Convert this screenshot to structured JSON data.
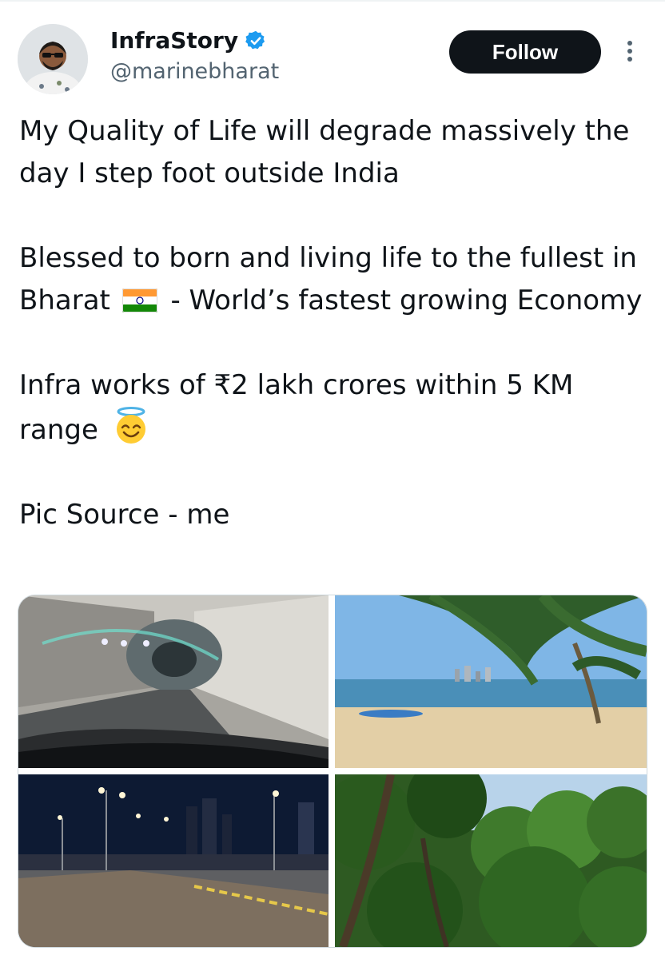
{
  "author": {
    "display_name": "InfraStory",
    "handle": "@marinebharat",
    "verified": true,
    "avatar_icon": "user-avatar"
  },
  "actions": {
    "follow_label": "Follow",
    "more_icon": "more-vertical-icon"
  },
  "tweet": {
    "paragraph_1": "My Quality of Life will degrade massively the day I step foot outside India",
    "paragraph_2_before_flag": "Blessed to born and living life to the fullest in Bharat",
    "paragraph_2_flag_icon": "india-flag-emoji",
    "paragraph_2_after_flag": "- World’s fastest growing Economy",
    "paragraph_3_text": "Infra works of ₹2 lakh crores within 5 KM range",
    "paragraph_3_emoji_icon": "smiling-face-with-halo-emoji",
    "paragraph_4": "Pic Source - me"
  },
  "media": [
    {
      "subject": "tunnel-photo"
    },
    {
      "subject": "beach-photo"
    },
    {
      "subject": "night-road-photo"
    },
    {
      "subject": "forest-photo"
    }
  ],
  "colors": {
    "text": "#0f1419",
    "secondary_text": "#536471",
    "verified_blue": "#1d9bf0",
    "button_bg": "#0f1419"
  }
}
